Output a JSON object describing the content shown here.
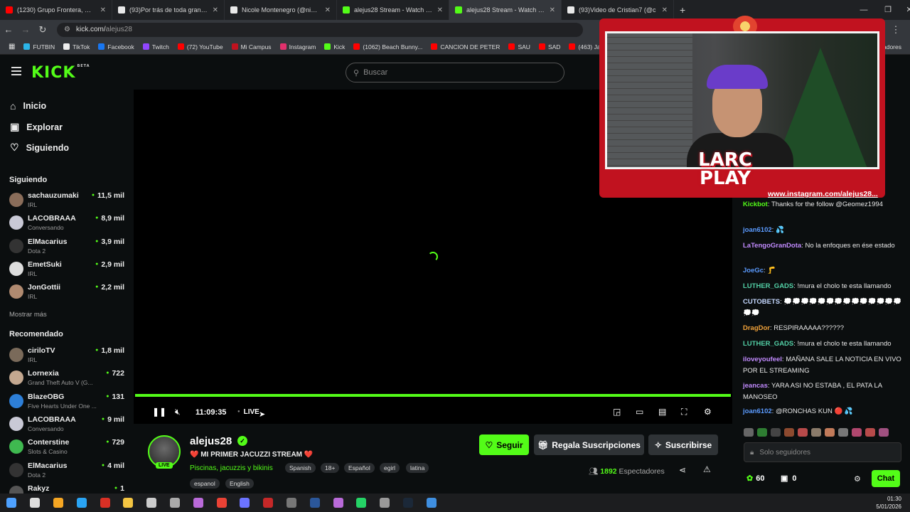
{
  "browser": {
    "tabs": [
      {
        "title": "(1230) Grupo Frontera, Manuel",
        "color": "#ff0000"
      },
      {
        "title": "(93)Por trás de toda grande obr",
        "color": "#e9e9e9"
      },
      {
        "title": "Nicole Montenegro (@nicolem",
        "color": "#e9e9e9"
      },
      {
        "title": "alejus28 Stream - Watch Live o",
        "color": "#53fc18"
      },
      {
        "title": "alejus28 Stream - Watch Live o",
        "color": "#53fc18"
      },
      {
        "title": "(93)Video de Cristian7 (@c",
        "color": "#e9e9e9"
      }
    ],
    "new_tab": "+",
    "url_prefix": "kick.com/",
    "url_path": "alejus28",
    "bookmarks": [
      {
        "label": "FUTBIN",
        "color": "#2bb5e8"
      },
      {
        "label": "TikTok",
        "color": "#eee"
      },
      {
        "label": "Facebook",
        "color": "#1877f2"
      },
      {
        "label": "Twitch",
        "color": "#9146ff"
      },
      {
        "label": "(72) YouTube",
        "color": "#ff0000"
      },
      {
        "label": "Mi Campus",
        "color": "#c1121f"
      },
      {
        "label": "Instagram",
        "color": "#e1306c"
      },
      {
        "label": "Kick",
        "color": "#53fc18"
      },
      {
        "label": "(1062) Beach Bunny...",
        "color": "#ff0000"
      },
      {
        "label": "CANCION DE PETER",
        "color": "#ff0000"
      },
      {
        "label": "SAU",
        "color": "#ff0000"
      },
      {
        "label": "SAD",
        "color": "#ff0000"
      },
      {
        "label": "(463) James Arthu",
        "color": "#ff0000"
      }
    ],
    "bookmarks_more": "cadores"
  },
  "kick": {
    "logo": "KICK",
    "logo_badge": "BETA",
    "search_placeholder": "Buscar"
  },
  "sidebar": {
    "nav": [
      {
        "label": "Inicio",
        "icon": "home-icon",
        "glyph": "⌂"
      },
      {
        "label": "Explorar",
        "icon": "browse-icon",
        "glyph": "▣"
      },
      {
        "label": "Siguiendo",
        "icon": "heart-icon",
        "glyph": "♡"
      }
    ],
    "following_header": "Siguiendo",
    "following": [
      {
        "name": "sachauzumaki",
        "category": "IRL",
        "viewers": "11,5 mil",
        "color": "#8a6d5a"
      },
      {
        "name": "LACOBRAAA",
        "category": "Conversando",
        "viewers": "8,9 mil",
        "color": "#c9c9d6"
      },
      {
        "name": "ElMacarius",
        "category": "Dota 2",
        "viewers": "3,9 mil",
        "color": "#333"
      },
      {
        "name": "EmetSuki",
        "category": "IRL",
        "viewers": "2,9 mil",
        "color": "#ddd"
      },
      {
        "name": "JonGottii",
        "category": "IRL",
        "viewers": "2,2 mil",
        "color": "#b08a70"
      }
    ],
    "show_more": "Mostrar más",
    "recommended_header": "Recomendado",
    "recommended": [
      {
        "name": "ciriloTV",
        "category": "IRL",
        "viewers": "1,8 mil",
        "color": "#7a6a5a"
      },
      {
        "name": "Lornexia",
        "category": "Grand Theft Auto V (G...",
        "viewers": "722",
        "color": "#c4a890"
      },
      {
        "name": "BlazeOBG",
        "category": "Five Hearts Under One ...",
        "viewers": "131",
        "color": "#2d7fd8"
      },
      {
        "name": "LACOBRAAA",
        "category": "Conversando",
        "viewers": "9 mil",
        "color": "#c9c9d6"
      },
      {
        "name": "Conterstine",
        "category": "Slots & Casino",
        "viewers": "729",
        "color": "#3fb950"
      },
      {
        "name": "ElMacarius",
        "category": "Dota 2",
        "viewers": "4 mil",
        "color": "#333"
      },
      {
        "name": "Rakyz",
        "category": "",
        "viewers": "1",
        "color": "#555"
      }
    ]
  },
  "player": {
    "time": "11:09:35",
    "live": "LIVE",
    "progress": 1.0
  },
  "stream": {
    "name": "alejus28",
    "live_badge": "LIVE",
    "title": "❤️ MI PRIMER JACUZZI STREAM ❤️",
    "category": "Piscinas, jacuzzis y bikinis",
    "tags": [
      "Spanish",
      "18+",
      "Español",
      "egirl",
      "latina",
      "espanol",
      "English"
    ],
    "follow": "Seguir",
    "gift": "Regala Suscripciones",
    "subscribe": "Suscribirse",
    "viewers": "1892",
    "viewers_label": "Espectadores"
  },
  "overlay": {
    "brand_line1": "LARC",
    "brand_line2": "PLAY",
    "instagram": "www.instagram.com/alejus28..."
  },
  "chat": {
    "messages": [
      {
        "user": "Kickbot",
        "color": "#53fc18",
        "text": "Thanks for the follow @Geomez1994"
      },
      {
        "user": "joan6102",
        "color": "#5b9bff",
        "text": "💦"
      },
      {
        "user": "LaTengoGranDota",
        "color": "#c28bff",
        "text": "No la enfoques en ése estado"
      },
      {
        "user": "JoeGc",
        "color": "#5b9bff",
        "text": "🦵"
      },
      {
        "user": "LUTHER_GADS",
        "color": "#53d1a7",
        "text": "!mura el cholo te esta llamando"
      },
      {
        "user": "CUTOBETS",
        "color": "#c5d8ff",
        "text": "💭💭💭💭💭💭💭💭💭💭💭💭💭💭💭💭"
      },
      {
        "user": "DragDor",
        "color": "#f2a33a",
        "text": "RESPIRAAAAA??????"
      },
      {
        "user": "LUTHER_GADS",
        "color": "#53d1a7",
        "text": "!mura el cholo te esta llamando"
      },
      {
        "user": "iloveyoufeel",
        "color": "#c28bff",
        "text": "MAÑANA SALE LA NOTICIA EN VIVO POR EL STREAMING"
      },
      {
        "user": "jeancas",
        "color": "#c28bff",
        "text": "YARA ASI NO ESTABA , EL PATA LA MANOSEO"
      },
      {
        "user": "joan6102",
        "color": "#5b9bff",
        "text": "@RONCHAS KUN 🔴 💦"
      }
    ],
    "input_placeholder": "Solo seguidores",
    "points": "60",
    "chest": "0",
    "send": "Chat"
  },
  "taskbar": {
    "icons": [
      "windows-start-icon",
      "search-icon",
      "store-icon",
      "edge-icon",
      "app-icon",
      "files-icon",
      "app-icon",
      "app-icon",
      "app-icon",
      "chrome-icon",
      "app-icon",
      "app-icon",
      "calculator-icon",
      "word-icon",
      "app-icon",
      "whatsapp-icon",
      "app-icon",
      "steam-icon",
      "app-icon"
    ],
    "time": "01:30",
    "date": "5/01/2026"
  }
}
